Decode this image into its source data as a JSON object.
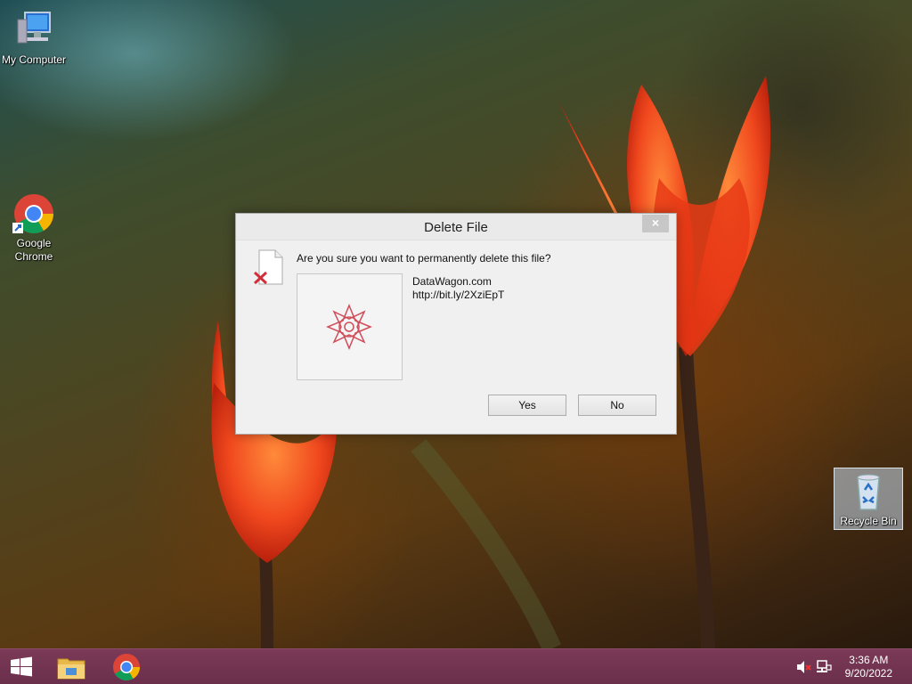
{
  "desktop": {
    "icons": [
      {
        "label": "My Computer",
        "icon": "computer-icon"
      },
      {
        "label": "Google Chrome",
        "icon": "chrome-icon"
      },
      {
        "label": "Recycle Bin",
        "icon": "recycle-bin-icon"
      }
    ]
  },
  "dialog": {
    "title": "Delete File",
    "close_label": "×",
    "question": "Are you sure you want to permanently delete this file?",
    "file_name": "DataWagon.com",
    "file_link": "http://bit.ly/2XziEpT",
    "yes_label": "Yes",
    "no_label": "No"
  },
  "taskbar": {
    "items": [
      "start-icon",
      "file-explorer-icon",
      "chrome-icon"
    ],
    "tray": [
      "speaker-muted-icon",
      "network-icon"
    ],
    "time": "3:36 AM",
    "date": "9/20/2022"
  },
  "colors": {
    "taskbar": "#6e3150",
    "dialog_bg": "#f0f0f0",
    "accent_red": "#d0303a"
  }
}
